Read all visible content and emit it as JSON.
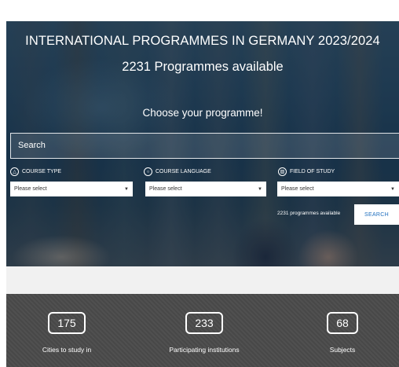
{
  "hero": {
    "title": "INTERNATIONAL PROGRAMMES IN GERMANY 2023/2024",
    "subtitle": "2231 Programmes available",
    "choose": "Choose your programme!",
    "search_placeholder": "Search"
  },
  "filters": [
    {
      "label": "COURSE TYPE",
      "icon": "mortarboard-icon",
      "value": "Please select"
    },
    {
      "label": "COURSE LANGUAGE",
      "icon": "speech-bubble-icon",
      "value": "Please select"
    },
    {
      "label": "FIELD OF STUDY",
      "icon": "books-icon",
      "value": "Please select"
    }
  ],
  "results": {
    "available": "2231 programmes available",
    "search_button": "SEARCH"
  },
  "stats": [
    {
      "value": "175",
      "label": "Cities to study in"
    },
    {
      "value": "233",
      "label": "Participating institutions"
    },
    {
      "value": "68",
      "label": "Subjects"
    }
  ],
  "colors": {
    "stats_background": "#4a4a4a",
    "search_button_text": "#1f6fbf"
  }
}
